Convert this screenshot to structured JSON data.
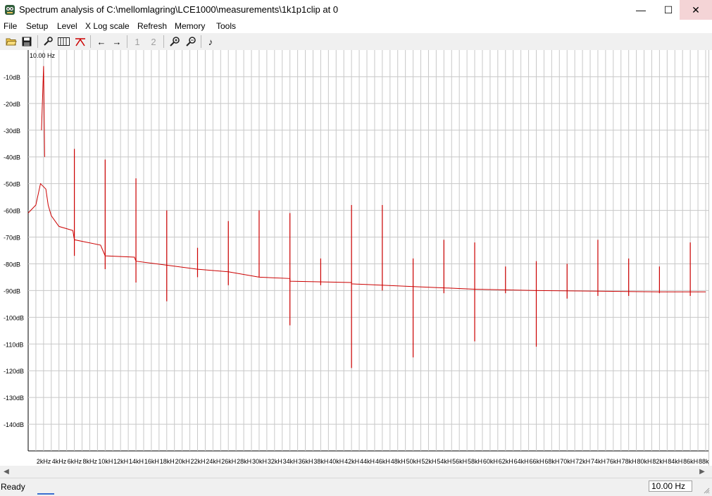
{
  "window": {
    "title": "Spectrum analysis of C:\\mellomlagring\\LCE1000\\measurements\\1k1p1clip at 0",
    "minimize": "—",
    "maximize": "☐",
    "close": "✕"
  },
  "menu": {
    "items": [
      "File",
      "Setup",
      "Level",
      "X Log scale",
      "Refresh",
      "Memory",
      "Tools"
    ]
  },
  "toolbar": {
    "memory_slot_1": "1",
    "memory_slot_2": "2",
    "icons": [
      "open-folder-icon",
      "save-icon",
      "settings-wrench-icon",
      "window-icon",
      "peak-marker-icon",
      "arrow-left-icon",
      "arrow-right-icon",
      "zoom-in-icon",
      "zoom-out-icon",
      "music-note-icon"
    ]
  },
  "status": {
    "text": "Ready",
    "resolution": "10.00 Hz"
  },
  "chart_data": {
    "type": "line",
    "cursor_readout": "10.00 Hz",
    "x_unit": "Hz",
    "x_range": [
      0,
      88000
    ],
    "y_range": [
      0,
      -150
    ],
    "y_ticks": [
      -10,
      -20,
      -30,
      -40,
      -50,
      -60,
      -70,
      -80,
      -90,
      -100,
      -110,
      -120,
      -130,
      -140
    ],
    "y_tick_labels": [
      "-10dB",
      "-20dB",
      "-30dB",
      "-40dB",
      "-50dB",
      "-60dB",
      "-70dB",
      "-80dB",
      "-90dB",
      "-100dB",
      "-110dB",
      "-120dB",
      "-130dB",
      "-140dB"
    ],
    "x_ticks": [
      2000,
      4000,
      6000,
      8000,
      10000,
      12000,
      14000,
      16000,
      18000,
      20000,
      22000,
      24000,
      26000,
      28000,
      30000,
      32000,
      34000,
      36000,
      38000,
      40000,
      42000,
      44000,
      46000,
      48000,
      50000,
      52000,
      54000,
      56000,
      58000,
      60000,
      62000,
      64000,
      66000,
      68000,
      70000,
      72000,
      74000,
      76000,
      78000,
      80000,
      82000,
      84000,
      86000,
      88000
    ],
    "x_tick_labels": [
      "2kHz",
      "4kHz",
      "6kHz",
      "8kHz",
      "10kH",
      "12kH",
      "14kH",
      "16kH",
      "18kH",
      "20kH",
      "22kH",
      "24kH",
      "26kH",
      "28kH",
      "30kH",
      "32kH",
      "34kH",
      "36kH",
      "38kH",
      "40kH",
      "42kH",
      "44kH",
      "46kH",
      "48kH",
      "50kH",
      "52kH",
      "54kH",
      "56kH",
      "58kH",
      "60kH",
      "62kH",
      "64kH",
      "66kH",
      "68kH",
      "70kH",
      "72kH",
      "74kH",
      "76kH",
      "78kH",
      "80kH",
      "82kH",
      "84kH",
      "86kH",
      "88kH"
    ],
    "grid": true,
    "series": [
      {
        "color": "#cc0000",
        "fundamental": {
          "x": 2000,
          "y": -6
        },
        "floor": [
          {
            "x": 0,
            "y": -61
          },
          {
            "x": 1000,
            "y": -58
          },
          {
            "x": 1600,
            "y": -50
          },
          {
            "x": 2300,
            "y": -52
          },
          {
            "x": 2600,
            "y": -58
          },
          {
            "x": 3000,
            "y": -62
          },
          {
            "x": 4000,
            "y": -66
          },
          {
            "x": 5800,
            "y": -67.5
          },
          {
            "x": 6000,
            "y": -71
          },
          {
            "x": 9400,
            "y": -73
          },
          {
            "x": 10000,
            "y": -77
          },
          {
            "x": 13800,
            "y": -77.5
          },
          {
            "x": 14000,
            "y": -79
          },
          {
            "x": 18000,
            "y": -80.5
          },
          {
            "x": 22000,
            "y": -82
          },
          {
            "x": 26000,
            "y": -83
          },
          {
            "x": 30000,
            "y": -85
          },
          {
            "x": 34000,
            "y": -85.5
          },
          {
            "x": 34000,
            "y": -86.5
          },
          {
            "x": 42000,
            "y": -87
          },
          {
            "x": 42000,
            "y": -87.5
          },
          {
            "x": 50000,
            "y": -88.5
          },
          {
            "x": 58000,
            "y": -89.5
          },
          {
            "x": 66000,
            "y": -90
          },
          {
            "x": 74000,
            "y": -90.2
          },
          {
            "x": 82000,
            "y": -90.5
          },
          {
            "x": 86000,
            "y": -90.5
          },
          {
            "x": 88000,
            "y": -90.5
          }
        ],
        "spikes": [
          {
            "x": 6000,
            "top": -37,
            "bottom": -77
          },
          {
            "x": 10000,
            "top": -41,
            "bottom": -82
          },
          {
            "x": 14000,
            "top": -48,
            "bottom": -87
          },
          {
            "x": 18000,
            "top": -60,
            "bottom": -94
          },
          {
            "x": 22000,
            "top": -74,
            "bottom": -85
          },
          {
            "x": 26000,
            "top": -64,
            "bottom": -88
          },
          {
            "x": 30000,
            "top": -60,
            "bottom": -85
          },
          {
            "x": 34000,
            "top": -61,
            "bottom": -103
          },
          {
            "x": 38000,
            "top": -78,
            "bottom": -88
          },
          {
            "x": 42000,
            "top": -58,
            "bottom": -119
          },
          {
            "x": 46000,
            "top": -58,
            "bottom": -90
          },
          {
            "x": 50000,
            "top": -78,
            "bottom": -115
          },
          {
            "x": 54000,
            "top": -71,
            "bottom": -91
          },
          {
            "x": 58000,
            "top": -72,
            "bottom": -109
          },
          {
            "x": 62000,
            "top": -81,
            "bottom": -91
          },
          {
            "x": 66000,
            "top": -79,
            "bottom": -111
          },
          {
            "x": 70000,
            "top": -80,
            "bottom": -93
          },
          {
            "x": 74000,
            "top": -71,
            "bottom": -92
          },
          {
            "x": 78000,
            "top": -78,
            "bottom": -92
          },
          {
            "x": 82000,
            "top": -81,
            "bottom": -91
          },
          {
            "x": 86000,
            "top": -72,
            "bottom": -92
          }
        ]
      }
    ]
  }
}
